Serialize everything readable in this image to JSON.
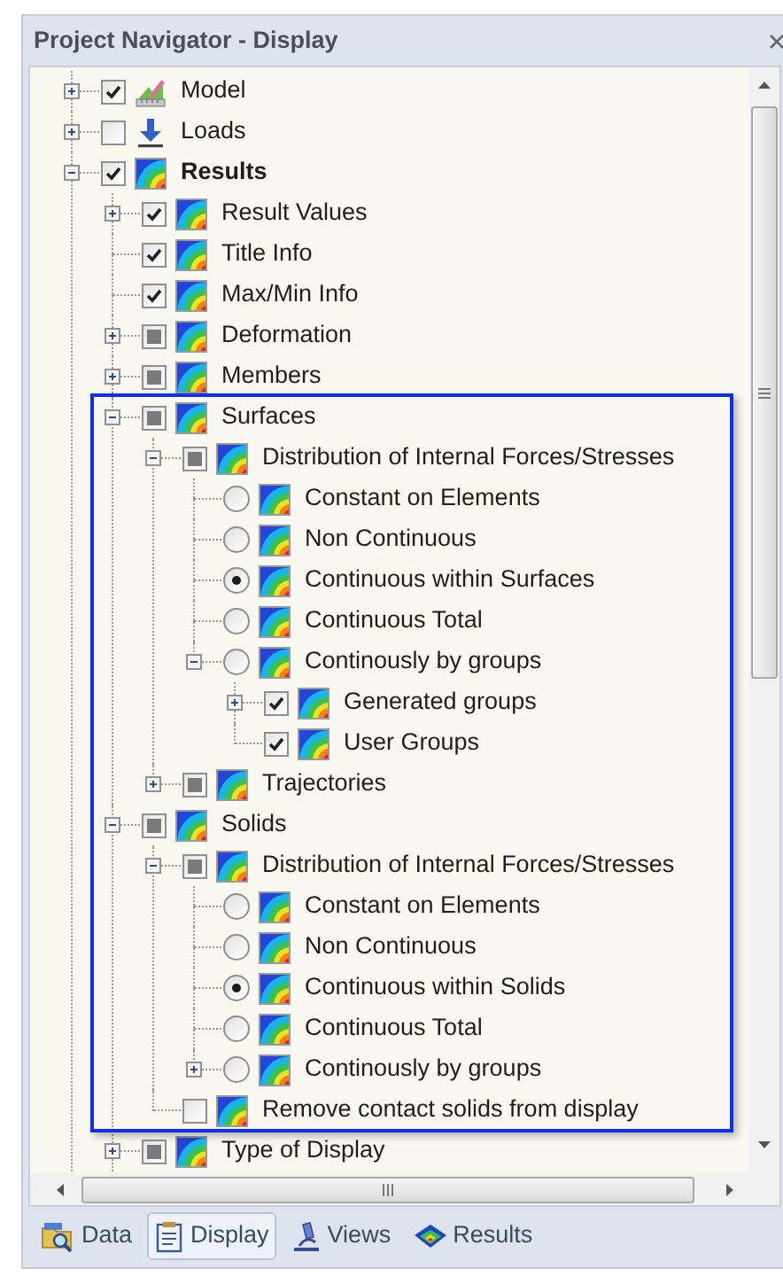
{
  "window": {
    "title": "Project Navigator - Display"
  },
  "tree": [
    {
      "label": "Model",
      "bold": false,
      "kind": "checkbox",
      "checked": true,
      "expanded": false
    },
    {
      "label": "Loads",
      "bold": false,
      "kind": "checkbox",
      "checked": false,
      "partial": false,
      "expanded": false
    },
    {
      "label": "Results",
      "bold": true,
      "kind": "checkbox",
      "checked": true,
      "expanded": true,
      "children": [
        {
          "label": "Result Values",
          "kind": "checkbox",
          "checked": true,
          "expanded": false,
          "highlighted": false
        },
        {
          "label": "Title Info",
          "kind": "checkbox",
          "checked": true,
          "highlighted": false
        },
        {
          "label": "Max/Min Info",
          "kind": "checkbox",
          "checked": true,
          "highlighted": false
        },
        {
          "label": "Deformation",
          "kind": "checkbox",
          "checked": false,
          "partial": true,
          "expanded": false,
          "highlighted": false
        },
        {
          "label": "Members",
          "kind": "checkbox",
          "checked": false,
          "partial": true,
          "expanded": false,
          "highlighted": false
        },
        {
          "label": "Surfaces",
          "kind": "checkbox",
          "checked": false,
          "partial": true,
          "expanded": true,
          "highlighted": true,
          "children": [
            {
              "label": "Distribution of Internal Forces/Stresses",
              "kind": "checkbox",
              "checked": false,
              "partial": true,
              "expanded": true,
              "children": [
                {
                  "label": "Constant on Elements",
                  "kind": "radio",
                  "checked": false
                },
                {
                  "label": "Non Continuous",
                  "kind": "radio",
                  "checked": false
                },
                {
                  "label": "Continuous within Surfaces",
                  "kind": "radio",
                  "checked": true
                },
                {
                  "label": "Continuous Total",
                  "kind": "radio",
                  "checked": false
                },
                {
                  "label": "Continously by groups",
                  "kind": "radio",
                  "checked": false,
                  "expanded": true,
                  "children": [
                    {
                      "label": "Generated groups",
                      "kind": "checkbox",
                      "checked": true,
                      "expanded": false
                    },
                    {
                      "label": "User Groups",
                      "kind": "checkbox",
                      "checked": true
                    }
                  ]
                }
              ]
            },
            {
              "label": "Trajectories",
              "kind": "checkbox",
              "checked": false,
              "partial": true,
              "expanded": false
            }
          ]
        },
        {
          "label": "Solids",
          "kind": "checkbox",
          "checked": false,
          "partial": true,
          "expanded": true,
          "highlighted": true,
          "children": [
            {
              "label": "Distribution of Internal Forces/Stresses",
              "kind": "checkbox",
              "checked": false,
              "partial": true,
              "expanded": true,
              "children": [
                {
                  "label": "Constant on Elements",
                  "kind": "radio",
                  "checked": false
                },
                {
                  "label": "Non Continuous",
                  "kind": "radio",
                  "checked": false
                },
                {
                  "label": "Continuous within Solids",
                  "kind": "radio",
                  "checked": true
                },
                {
                  "label": "Continuous Total",
                  "kind": "radio",
                  "checked": false
                },
                {
                  "label": "Continously by groups",
                  "kind": "radio",
                  "checked": false,
                  "expanded": false
                }
              ]
            },
            {
              "label": "Remove contact solids from display",
              "kind": "checkbox",
              "checked": false,
              "partial": false
            }
          ]
        },
        {
          "label": "Type of Display",
          "kind": "checkbox",
          "checked": false,
          "partial": true,
          "expanded": false,
          "highlighted": false
        }
      ]
    }
  ],
  "tabs": [
    {
      "label": "Data",
      "selected": false
    },
    {
      "label": "Display",
      "selected": true
    },
    {
      "label": "Views",
      "selected": false
    },
    {
      "label": "Results",
      "selected": false
    }
  ]
}
